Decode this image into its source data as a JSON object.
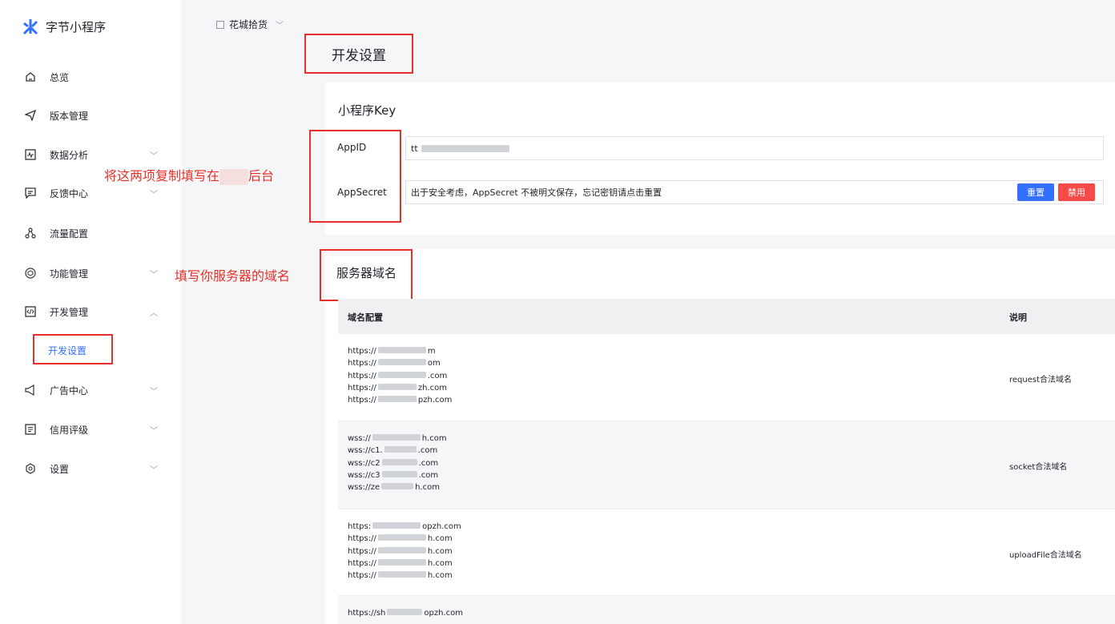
{
  "brand": {
    "name": "字节小程序",
    "accent": "#3370ff"
  },
  "sidebar": {
    "items": [
      {
        "label": "总览",
        "icon": "home-icon",
        "chevron": ""
      },
      {
        "label": "版本管理",
        "icon": "send-icon",
        "chevron": ""
      },
      {
        "label": "数据分析",
        "icon": "chart-icon",
        "chevron": "﹀"
      },
      {
        "label": "反馈中心",
        "icon": "feedback-icon",
        "chevron": "﹀"
      },
      {
        "label": "流量配置",
        "icon": "share-icon",
        "chevron": ""
      },
      {
        "label": "功能管理",
        "icon": "cube-icon",
        "chevron": "﹀"
      },
      {
        "label": "开发管理",
        "icon": "code-icon",
        "chevron": "︿"
      },
      {
        "label": "广告中心",
        "icon": "megaphone-icon",
        "chevron": "﹀"
      },
      {
        "label": "信用评级",
        "icon": "list-icon",
        "chevron": "﹀"
      },
      {
        "label": "设置",
        "icon": "gear-icon",
        "chevron": "﹀"
      }
    ],
    "sub_item": "开发设置"
  },
  "header": {
    "app_name": "花城拾货",
    "chevron": "﹀"
  },
  "page_title": "开发设置",
  "annotations": {
    "copy_note": "将这两项复制填写在",
    "copy_note_tail": "后台",
    "domain_note": "填写你服务器的域名"
  },
  "key_card": {
    "title": "小程序Key",
    "appid_label": "AppID",
    "appid_value": "tt",
    "secret_label": "AppSecret",
    "secret_hint": "出于安全考虑，AppSecret 不被明文保存，忘记密钥请点击重置",
    "reset_button": "重置",
    "disable_button": "禁用",
    "reset_color": "#3370ff",
    "disable_color": "#f54a45"
  },
  "domain_card": {
    "title": "服务器域名",
    "columns": [
      "域名配置",
      "说明"
    ],
    "rows": [
      {
        "domains": [
          "https://",
          "https://",
          "https://",
          "https://",
          "https://"
        ],
        "tails": [
          "m",
          "om",
          ".com",
          "zh.com",
          "pzh.com"
        ],
        "desc": "request合法域名"
      },
      {
        "domains": [
          "wss://",
          "wss://c1.",
          "wss://c2",
          "wss://c3",
          "wss://ze"
        ],
        "tails": [
          "h.com",
          ".com",
          ".com",
          ".com",
          "h.com"
        ],
        "desc": "socket合法域名"
      },
      {
        "domains": [
          "https:",
          "https://",
          "https://",
          "https://",
          "https://"
        ],
        "tails": [
          "opzh.com",
          "h.com",
          "h.com",
          "h.com",
          "h.com"
        ],
        "desc": "uploadFile合法域名"
      },
      {
        "domains": [
          "https://sh"
        ],
        "tails": [
          "opzh.com"
        ],
        "desc": ""
      }
    ]
  }
}
